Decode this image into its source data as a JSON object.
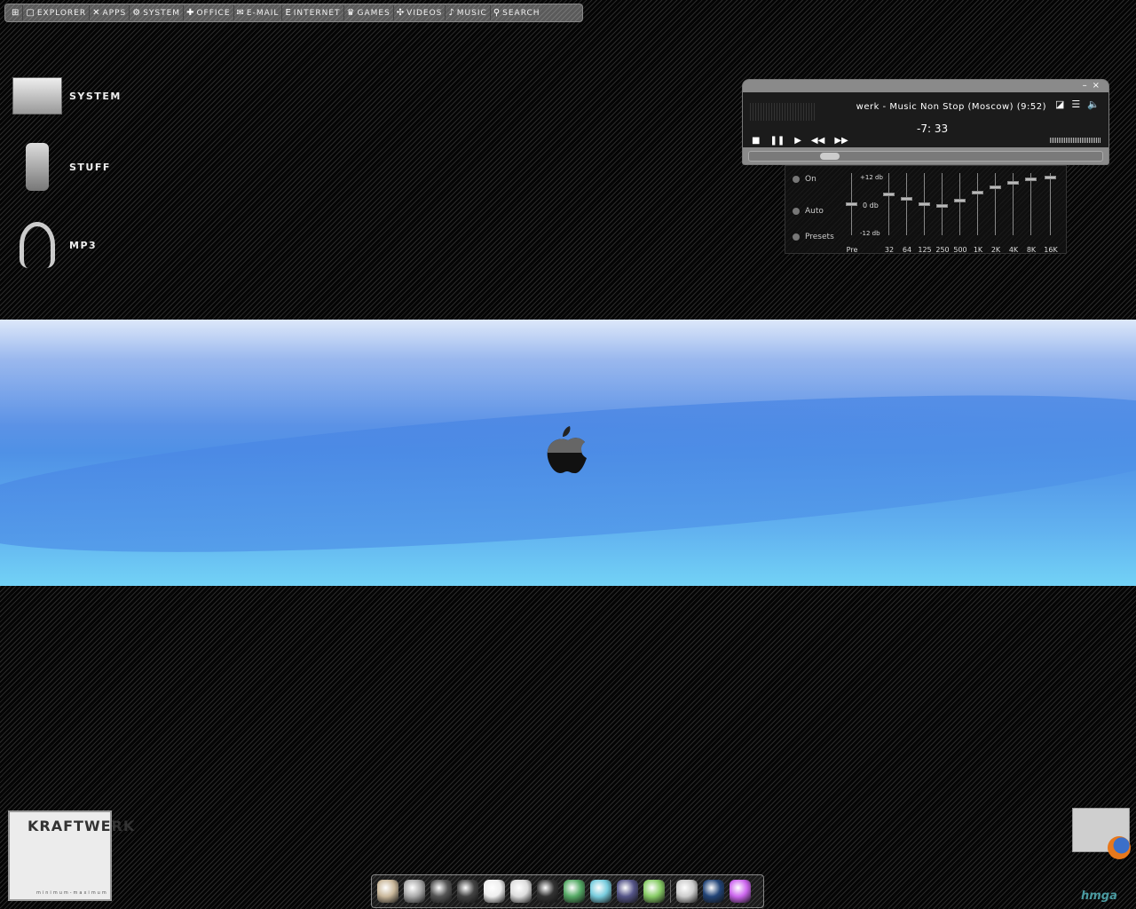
{
  "menubar": {
    "items": [
      {
        "label": "",
        "icon": "windows-icon",
        "glyph": "⊞"
      },
      {
        "label": "Explorer",
        "icon": "window-icon",
        "glyph": "▢"
      },
      {
        "label": "Apps",
        "icon": "tools-icon",
        "glyph": "✕"
      },
      {
        "label": "System",
        "icon": "gears-icon",
        "glyph": "⚙"
      },
      {
        "label": "Office",
        "icon": "puzzle-icon",
        "glyph": "✚"
      },
      {
        "label": "E-mail",
        "icon": "envelope-icon",
        "glyph": "✉"
      },
      {
        "label": "Internet",
        "icon": "ie-icon",
        "glyph": "e"
      },
      {
        "label": "Games",
        "icon": "chess-icon",
        "glyph": "♛"
      },
      {
        "label": "Videos",
        "icon": "film-reel-icon",
        "glyph": "✣"
      },
      {
        "label": "Music",
        "icon": "note-icon",
        "glyph": "♪"
      },
      {
        "label": "Search",
        "icon": "magnifier-icon",
        "glyph": "⚲"
      }
    ]
  },
  "desktop_icons": [
    {
      "label": "System",
      "icon": "computer-icon"
    },
    {
      "label": "Stuff",
      "icon": "camera-icon"
    },
    {
      "label": "MP3",
      "icon": "headphones-icon"
    }
  ],
  "player": {
    "track": "werk - Music Non Stop (Moscow) (9:52)",
    "time": "-7: 33",
    "progress": 0.2,
    "volume": 0.5,
    "controls": [
      "■",
      "❚❚",
      "▶",
      "◀◀",
      "▶▶"
    ],
    "window": [
      "–",
      "×"
    ],
    "tools": [
      "◪",
      "☰",
      "🔈"
    ]
  },
  "equalizer": {
    "options": [
      "On",
      "Auto",
      "Presets"
    ],
    "db_labels": [
      "+12 db",
      "0 db",
      "-12 db"
    ],
    "bands": [
      {
        "label": "Pre",
        "db": 0
      },
      {
        "label": "32",
        "db": 4
      },
      {
        "label": "64",
        "db": 2.3
      },
      {
        "label": "125",
        "db": 0
      },
      {
        "label": "250",
        "db": -0.7
      },
      {
        "label": "500",
        "db": 1.5
      },
      {
        "label": "1K",
        "db": 5
      },
      {
        "label": "2K",
        "db": 7
      },
      {
        "label": "4K",
        "db": 9
      },
      {
        "label": "8K",
        "db": 10.5
      },
      {
        "label": "16K",
        "db": 11
      }
    ]
  },
  "album": {
    "title": "KRAFTWERK",
    "subtitle": "minimum-maximum"
  },
  "corner_logo": "hmga",
  "dock": {
    "items": [
      "files",
      "hard-drive",
      "disk-utility",
      "x11",
      "ipod",
      "id-card",
      "camera",
      "photo-booth",
      "x",
      "podcast",
      "itunes",
      "|",
      "server",
      "quicktime",
      "potion"
    ],
    "colors": [
      "#c9b79a",
      "#aaa",
      "#555",
      "#444",
      "#eee",
      "#ddd",
      "#333",
      "#5a6",
      "#7cd",
      "#558",
      "#8c6",
      "",
      "#ccc",
      "#247",
      "#c6e"
    ]
  }
}
